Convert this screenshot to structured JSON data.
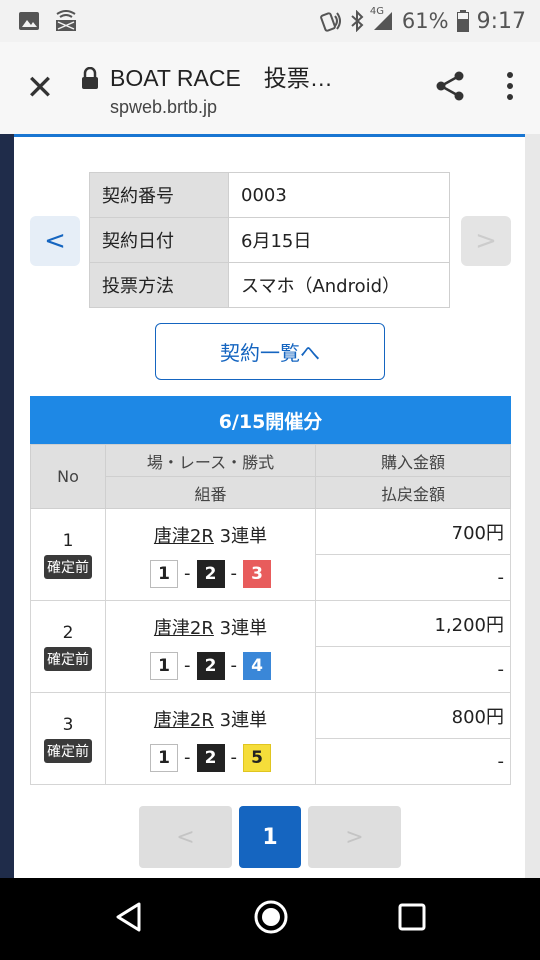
{
  "status_bar": {
    "signal": "4G",
    "battery": "61%",
    "time": "9:17"
  },
  "app_bar": {
    "title": "BOAT RACE　投票…",
    "url": "spweb.brtb.jp"
  },
  "contract": {
    "rows": [
      {
        "label": "契約番号",
        "value": "0003"
      },
      {
        "label": "契約日付",
        "value": "6月15日"
      },
      {
        "label": "投票方法",
        "value": "スマホ（Android）"
      }
    ],
    "list_button": "契約一覧へ",
    "prev_arrow": "<",
    "next_arrow": ">"
  },
  "section_title": "6/15開催分",
  "bet_table": {
    "headers": {
      "no": "No",
      "venue_race_type": "場・レース・勝式",
      "combination": "組番",
      "purchase": "購入金額",
      "payout": "払戻金額"
    },
    "rows": [
      {
        "no": "1",
        "status": "確定前",
        "race": "唐津2R",
        "bet_type": "3連単",
        "boats": [
          "1",
          "2",
          "3"
        ],
        "sep": "-",
        "purchase": "700円",
        "payout": "-"
      },
      {
        "no": "2",
        "status": "確定前",
        "race": "唐津2R",
        "bet_type": "3連単",
        "boats": [
          "1",
          "2",
          "4"
        ],
        "sep": "-",
        "purchase": "1,200円",
        "payout": "-"
      },
      {
        "no": "3",
        "status": "確定前",
        "race": "唐津2R",
        "bet_type": "3連単",
        "boats": [
          "1",
          "2",
          "5"
        ],
        "sep": "-",
        "purchase": "800円",
        "payout": "-"
      }
    ]
  },
  "pagination": {
    "prev": "<",
    "current": "1",
    "next": ">"
  }
}
